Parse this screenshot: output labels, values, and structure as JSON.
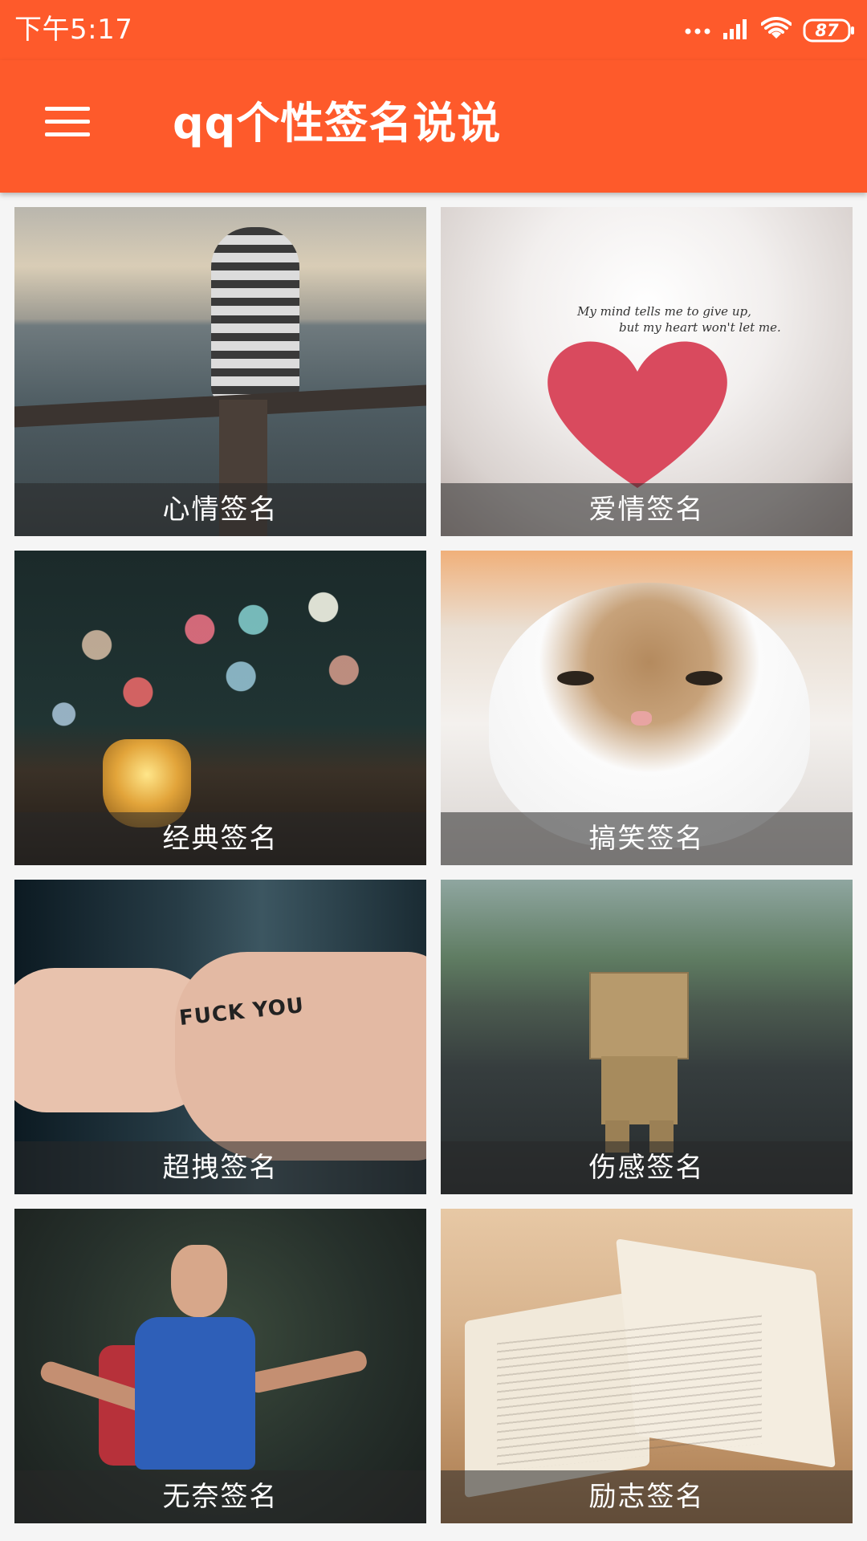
{
  "status_bar": {
    "time": "下午5:17",
    "battery": "87",
    "icons": [
      "more-dots-icon",
      "signal-icon",
      "wifi-icon",
      "battery-icon"
    ]
  },
  "app_bar": {
    "title": "qq个性签名说说",
    "menu_icon": "hamburger-menu-icon"
  },
  "colors": {
    "brand": "#fe5a2b",
    "background": "#f5f5f5",
    "caption_overlay": "rgba(40,40,40,0.55)"
  },
  "categories": [
    {
      "label": "心情签名"
    },
    {
      "label": "爱情签名"
    },
    {
      "label": "经典签名"
    },
    {
      "label": "搞笑签名"
    },
    {
      "label": "超拽签名"
    },
    {
      "label": "伤感签名"
    },
    {
      "label": "无奈签名"
    },
    {
      "label": "励志签名"
    }
  ],
  "image_text": {
    "love_quote_line1": "My mind tells me to give up,",
    "love_quote_line2": "but my heart won't let me.",
    "cool_tattoo": "FUCK YOU"
  }
}
